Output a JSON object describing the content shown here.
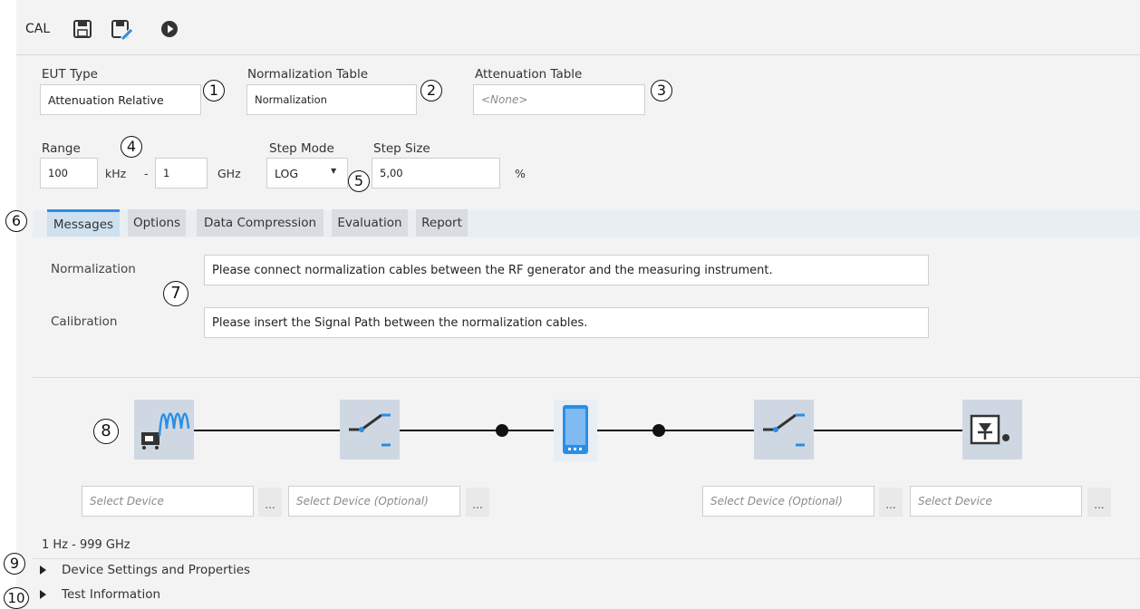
{
  "toolbar": {
    "title": "CAL",
    "icons": [
      "save-icon",
      "save-as-icon",
      "run-icon"
    ]
  },
  "fields": {
    "eut_type": {
      "label": "EUT Type",
      "value": "Attenuation Relative"
    },
    "normalization_table": {
      "label": "Normalization Table",
      "value": "Normalization"
    },
    "attenuation_table": {
      "label": "Attenuation Table",
      "placeholder": "<None>"
    },
    "range": {
      "label": "Range",
      "start_value": "100",
      "start_unit": "kHz",
      "separator": "-",
      "stop_value": "1",
      "stop_unit": "GHz"
    },
    "step_mode": {
      "label": "Step Mode",
      "value": "LOG"
    },
    "step_size": {
      "label": "Step Size",
      "value": "5,00",
      "unit": "%"
    }
  },
  "tabs": [
    "Messages",
    "Options",
    "Data Compression",
    "Evaluation",
    "Report"
  ],
  "active_tab": "Messages",
  "messages": {
    "normalization_label": "Normalization",
    "normalization_text": "Please connect normalization cables between the RF generator and the measuring instrument.",
    "calibration_label": "Calibration",
    "calibration_text": "Please insert the Signal Path between the normalization cables."
  },
  "signal_path": {
    "device_icons": [
      "signal-generator-icon",
      "switch-icon",
      "dut-icon",
      "switch-icon",
      "measuring-receiver-icon"
    ],
    "selectors": [
      "Select Device",
      "Select Device (Optional)",
      "Select Device (Optional)",
      "Select Device"
    ],
    "more_button": "..."
  },
  "frequency_range_text": "1 Hz - 999 GHz",
  "sections": {
    "device_settings": "Device Settings and Properties",
    "test_information": "Test Information"
  },
  "callouts": [
    "1",
    "2",
    "3",
    "4",
    "5",
    "6",
    "7",
    "8",
    "9",
    "10"
  ],
  "colors": {
    "accent": "#2a8ee6",
    "tab_bg": "#d9dde1",
    "device_bg": "#cfd8e2"
  }
}
